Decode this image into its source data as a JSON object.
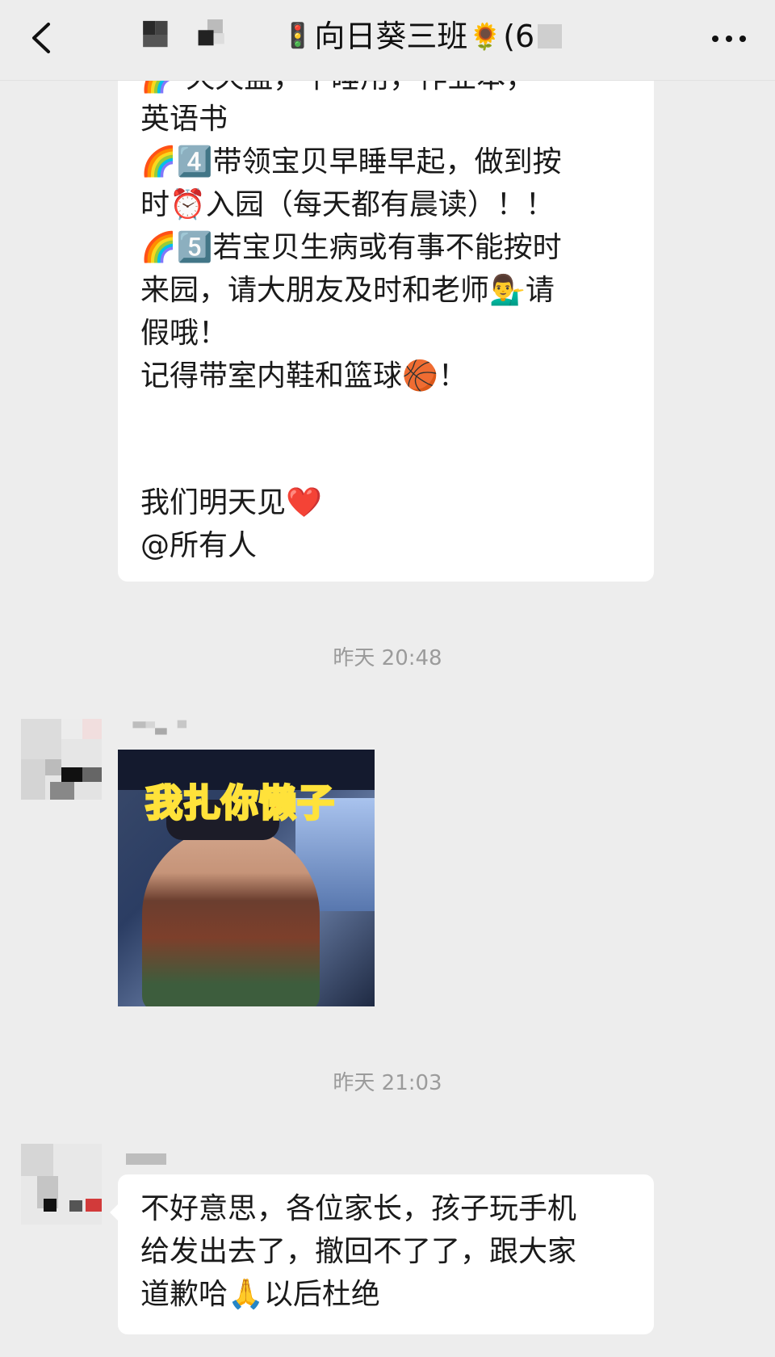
{
  "header": {
    "title": "向日葵三班",
    "title_suffix": "(6",
    "back_icon": "chevron-left-icon",
    "more_icon": "more-dots-icon",
    "title_lead_emoji": "🚦",
    "title_trail_emoji": "🌻"
  },
  "messages": [
    {
      "lines": [
        "🌈 天天盖，午睡用，作业本，",
        "英语书",
        "🌈4️⃣带领宝贝早睡早起，做到按",
        "时⏰入园（每天都有晨读）！！",
        "🌈5️⃣若宝贝生病或有事不能按时",
        "来园，请大朋友及时和老师💁‍♂️请",
        "假哦！",
        " 记得带室内鞋和篮球🏀！",
        "",
        "",
        "我们明天见❤️",
        "@所有人"
      ]
    }
  ],
  "timestamps": [
    "昨天 20:48",
    "昨天 21:03"
  ],
  "sticker": {
    "caption": "我扎你懒子"
  },
  "apology": {
    "lines": [
      "不好意思，各位家长，孩子玩手机",
      "给发出去了，撤回不了了，跟大家",
      "道歉哈🙏以后杜绝"
    ]
  },
  "colors": {
    "background": "#ededed",
    "bubble": "#ffffff",
    "timestamp": "#9b9b9b"
  }
}
